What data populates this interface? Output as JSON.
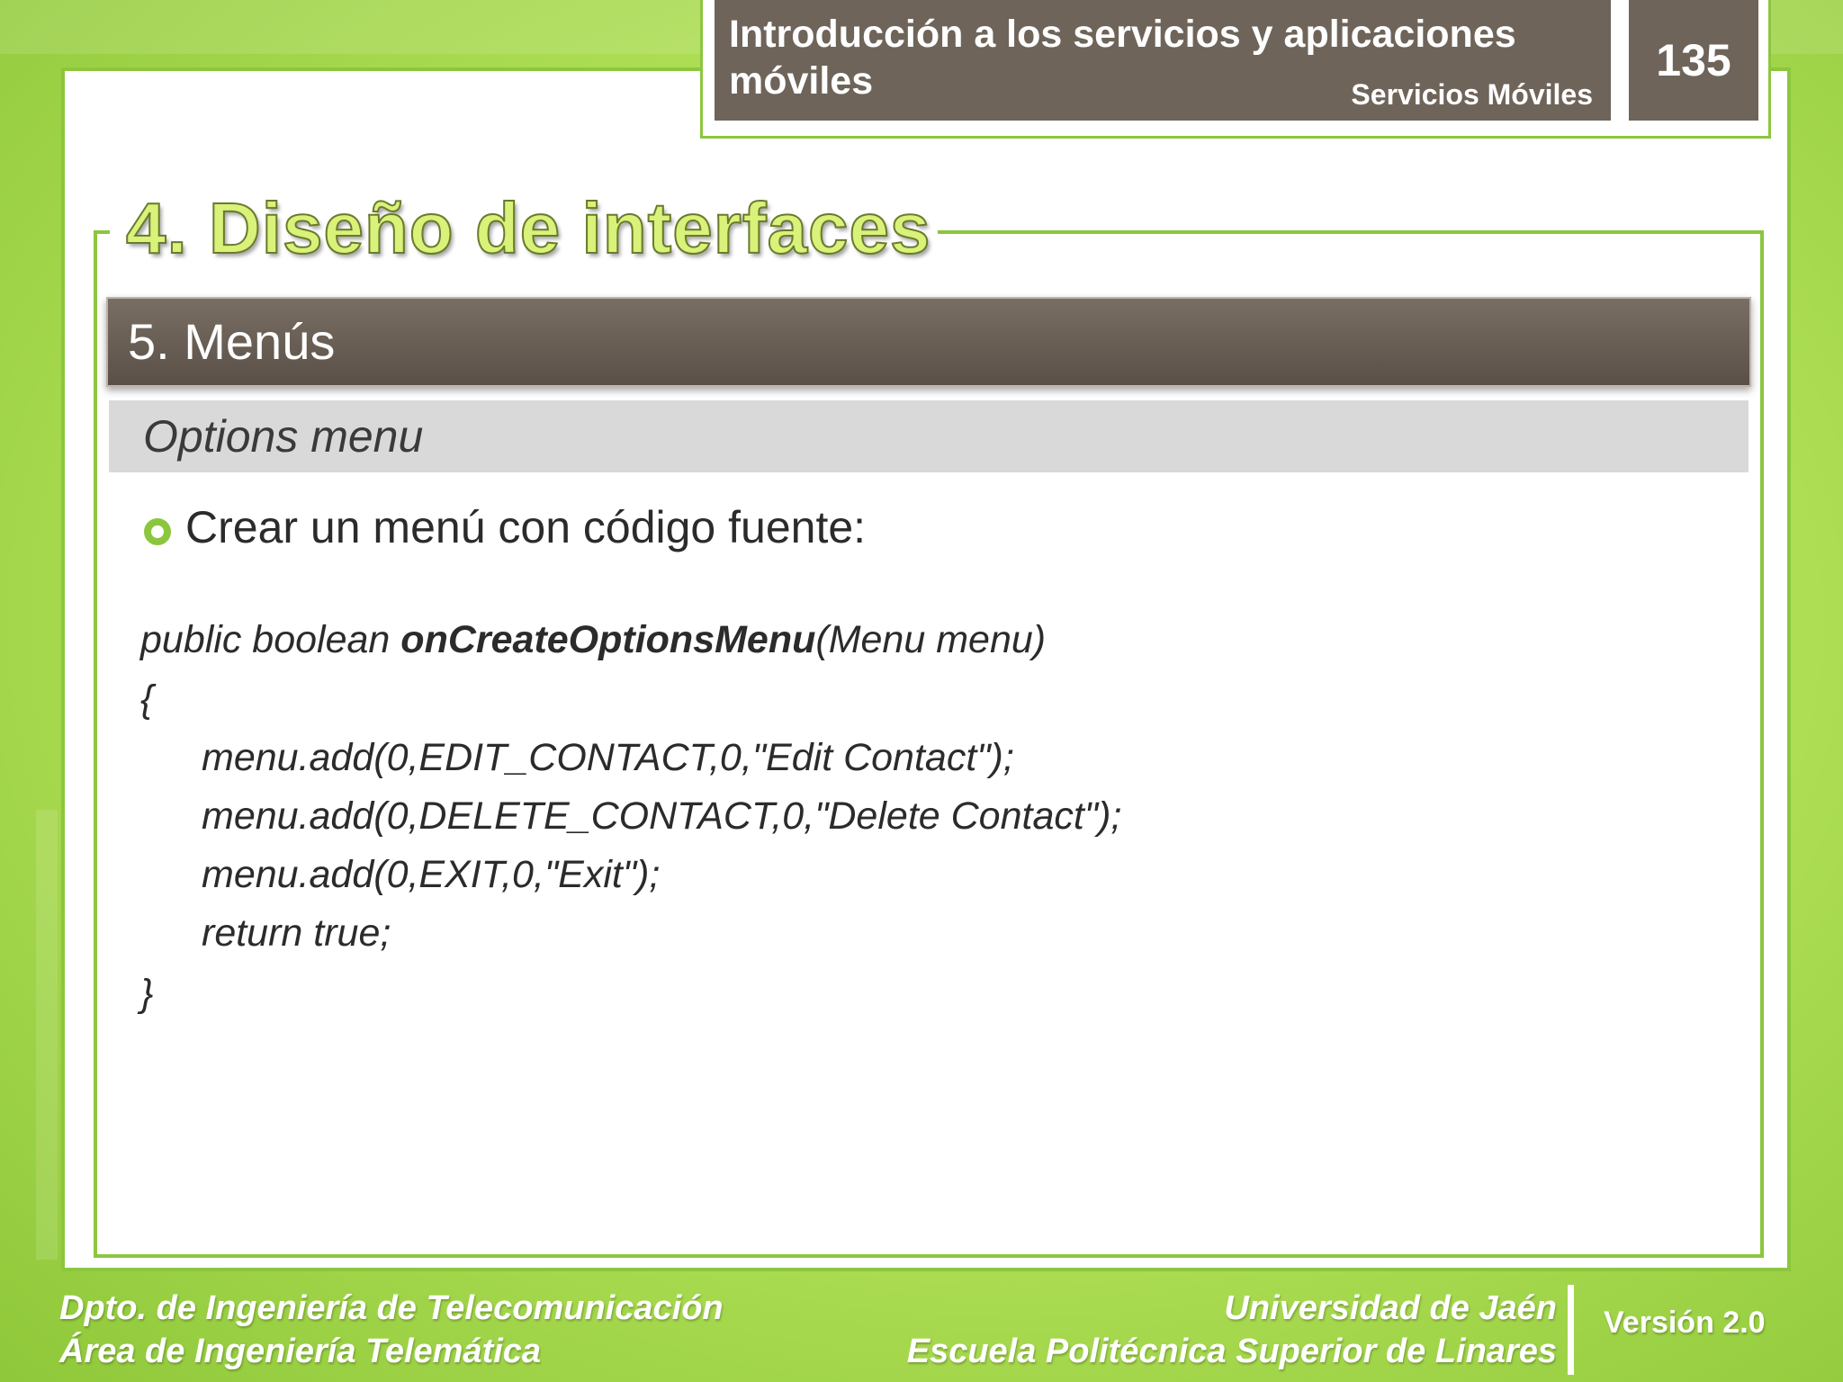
{
  "header": {
    "title": "Introducción a los servicios y aplicaciones móviles",
    "subtitle": "Servicios Móviles",
    "page_number": "135"
  },
  "section": {
    "title": "4. Diseño de interfaces",
    "subsection": "5. Menús",
    "topic": "Options menu"
  },
  "content": {
    "bullet": "Crear un menú con código fuente:",
    "code": {
      "signature_prefix": "public boolean ",
      "signature_method": "onCreateOptionsMenu",
      "signature_suffix": "(Menu menu)",
      "open_brace": "{",
      "lines": [
        "menu.add(0,EDIT_CONTACT,0,\"Edit Contact\");",
        "menu.add(0,DELETE_CONTACT,0,\"Delete Contact\");",
        "menu.add(0,EXIT,0,\"Exit\");",
        "return true;"
      ],
      "close_brace": "}"
    }
  },
  "footer": {
    "dept_line1": "Dpto. de Ingeniería de Telecomunicación",
    "dept_line2": "Área de Ingeniería Telemática",
    "univ_line1": "Universidad de Jaén",
    "univ_line2": "Escuela Politécnica Superior de Linares",
    "version": "Versión 2.0"
  },
  "colors": {
    "accent_green": "#8cc63f",
    "header_brown": "#6e645a",
    "topic_gray": "#d9d9d9"
  }
}
